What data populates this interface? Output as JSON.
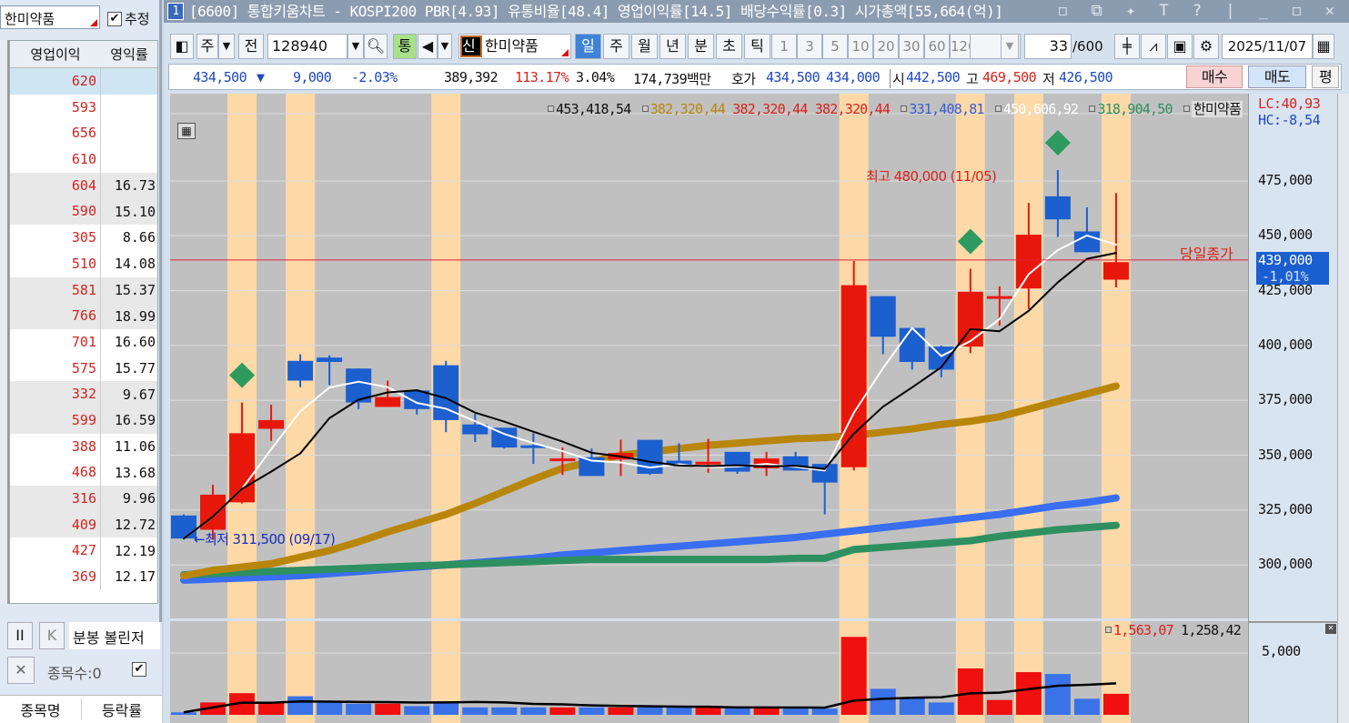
{
  "left_panel": {
    "search_value": "한미약품",
    "estimate_checkbox": {
      "label": "추정",
      "checked": true
    },
    "columns": [
      "영업이익",
      "영익률"
    ],
    "rows": [
      [
        "620",
        ""
      ],
      [
        "593",
        ""
      ],
      [
        "656",
        ""
      ],
      [
        "610",
        ""
      ],
      [
        "604",
        "16.73"
      ],
      [
        "590",
        "15.10"
      ],
      [
        "305",
        "8.66"
      ],
      [
        "510",
        "14.08"
      ],
      [
        "581",
        "15.37"
      ],
      [
        "766",
        "18.99"
      ],
      [
        "701",
        "16.60"
      ],
      [
        "575",
        "15.77"
      ],
      [
        "332",
        "9.67"
      ],
      [
        "599",
        "16.59"
      ],
      [
        "388",
        "11.06"
      ],
      [
        "468",
        "13.68"
      ],
      [
        "316",
        "9.96"
      ],
      [
        "409",
        "12.72"
      ],
      [
        "427",
        "12.19"
      ],
      [
        "369",
        "12.17"
      ]
    ],
    "bottom": {
      "pause": "II",
      "k": "K",
      "condition": "분봉 볼린저",
      "close": "✕",
      "count": "종목수:0",
      "columns": [
        "종목명",
        "등락률"
      ]
    }
  },
  "window": {
    "number": "1",
    "title": "[6600] 통합키움차트 - KOSPI200 PBR[4.93] 유통비율[48.4] 영업이익률[14.5] 배당수익률[0.3] 시가총액[55,664(억)]",
    "buttons": "◻ ⧉ ✦ T ? | _ ◻ ✕"
  },
  "toolbar": {
    "market": "주",
    "all": "전",
    "code": "128940",
    "tong": "통",
    "shin": "신",
    "name": "한미약품",
    "periods": [
      "일",
      "주",
      "월",
      "년",
      "분",
      "초",
      "틱"
    ],
    "active_period": "일",
    "intervals": [
      "1",
      "3",
      "5",
      "10",
      "20",
      "30",
      "60",
      "120"
    ],
    "count": "33",
    "count_total": "/600",
    "date": "2025/11/07"
  },
  "quote": {
    "price": "434,500",
    "arrow": "▼",
    "change": "9,000",
    "change_pct": "-2.03%",
    "volume": "389,392",
    "vol_ratio": "113.17%",
    "turnover": "3.04%",
    "amount": "174,739백만",
    "hoga_label": "호가",
    "ask": "434,500",
    "bid": "434,000",
    "open_label": "시",
    "open": "442,500",
    "high_label": "고",
    "high": "469,500",
    "low_label": "저",
    "low": "426,500",
    "buy": "매수",
    "sell": "매도",
    "eval": "평"
  },
  "legend": {
    "ma_black": "453,418,54",
    "ma_gold": "382,320,44",
    "red1": "382,320,44",
    "red2": "382,320,44",
    "ma_blue": "331,408,81",
    "ma_white": "450,606,92",
    "ma_green": "318,904,50",
    "name": "한미약품"
  },
  "right_axis": {
    "lc": "LC:40,93",
    "hc": "HC:-8,54",
    "ticks": [
      "475,000",
      "450,000",
      "425,000",
      "400,000",
      "375,000",
      "350,000",
      "325,000",
      "300,000"
    ],
    "close_value": "439,000",
    "close_pct": "-1,01%",
    "vol_tick": "5,000"
  },
  "annotations": {
    "high": "최고 480,000 (11/05)",
    "low": "←최저 311,500 (09/17)",
    "close_line": "당일종가"
  },
  "volume_legend": {
    "v1": "1,563,07",
    "v2": "1,258,42"
  },
  "colors": {
    "up": "#e8170c",
    "down": "#1c5fcf",
    "band": "#fdd9a8",
    "bg": "#c0c0c0",
    "gold": "#b8860b",
    "blue": "#3a6ef0",
    "green": "#2e9060",
    "signal": "#2e9a60"
  },
  "chart_data": {
    "type": "candlestick",
    "ylim": [
      290000,
      490000
    ],
    "close_line": 439000,
    "ohlc": [
      [
        322500,
        323000,
        311500,
        312000
      ],
      [
        316000,
        336500,
        311500,
        332000
      ],
      [
        328500,
        374000,
        328000,
        360000
      ],
      [
        362000,
        373000,
        356500,
        366000
      ],
      [
        393000,
        396000,
        381000,
        384000
      ],
      [
        394500,
        395500,
        382000,
        392500
      ],
      [
        389500,
        389500,
        371000,
        374000
      ],
      [
        372000,
        384000,
        372000,
        376500
      ],
      [
        379500,
        380000,
        368500,
        371000
      ],
      [
        391000,
        393000,
        360500,
        366000
      ],
      [
        364000,
        369000,
        356000,
        359500
      ],
      [
        362500,
        362500,
        353000,
        353500
      ],
      [
        354500,
        360000,
        346000,
        353500
      ],
      [
        347500,
        353500,
        341000,
        348500
      ],
      [
        349000,
        353000,
        340500,
        340500
      ],
      [
        348000,
        357000,
        340500,
        351000
      ],
      [
        357000,
        357000,
        341000,
        341500
      ],
      [
        347500,
        355500,
        345000,
        345000
      ],
      [
        346000,
        357500,
        342000,
        347000
      ],
      [
        351500,
        351500,
        341500,
        342500
      ],
      [
        344000,
        351500,
        340500,
        348500
      ],
      [
        349500,
        351500,
        343000,
        343000
      ],
      [
        346000,
        346000,
        323000,
        337500
      ],
      [
        344500,
        438500,
        343000,
        427500
      ],
      [
        422500,
        422500,
        396000,
        404000
      ],
      [
        408000,
        408500,
        389000,
        392500
      ],
      [
        399500,
        400000,
        385500,
        389000
      ],
      [
        399500,
        435000,
        396500,
        424500
      ],
      [
        421500,
        427000,
        409000,
        422500
      ],
      [
        426000,
        465000,
        416500,
        450500
      ],
      [
        468000,
        480000,
        449500,
        457500
      ],
      [
        452000,
        463000,
        442500,
        442500
      ],
      [
        430000,
        469500,
        426500,
        438000
      ]
    ],
    "candle_colors": [
      "d",
      "u",
      "u",
      "u",
      "d",
      "d",
      "d",
      "u",
      "d",
      "d",
      "d",
      "d",
      "d",
      "u",
      "d",
      "u",
      "d",
      "d",
      "u",
      "d",
      "u",
      "d",
      "d",
      "u",
      "d",
      "d",
      "d",
      "u",
      "u",
      "u",
      "d",
      "d",
      "u"
    ],
    "band_indices": [
      2,
      4,
      9,
      23,
      27,
      29,
      32
    ],
    "signal_indices": [
      2,
      27,
      30
    ],
    "ma_gold": [
      295000,
      297500,
      299000,
      300500,
      303500,
      306500,
      310500,
      315000,
      319000,
      323000,
      328000,
      333500,
      339000,
      344000,
      347000,
      350000,
      351500,
      353000,
      354500,
      355500,
      356500,
      357500,
      358000,
      359000,
      360500,
      362000,
      364000,
      365500,
      367500,
      371000,
      374500,
      378000,
      381500
    ],
    "ma_blue": [
      293000,
      293500,
      294000,
      294500,
      295000,
      296000,
      297000,
      298000,
      299000,
      300000,
      301000,
      302000,
      303000,
      304500,
      305500,
      306500,
      307500,
      308500,
      309500,
      310500,
      311500,
      312500,
      314000,
      315500,
      317000,
      318500,
      320000,
      321500,
      323000,
      325000,
      327000,
      328500,
      330500
    ],
    "ma_green": [
      295500,
      296000,
      296500,
      297000,
      297500,
      298000,
      298500,
      299000,
      299500,
      300000,
      300500,
      301000,
      301500,
      302000,
      302500,
      302500,
      302500,
      302500,
      302500,
      302500,
      302500,
      303000,
      303000,
      307000,
      308000,
      309000,
      310000,
      311000,
      313000,
      314500,
      316000,
      317000,
      318000
    ],
    "volume": [
      0.2,
      1.0,
      1.75,
      0.95,
      1.5,
      1.0,
      0.9,
      0.9,
      0.7,
      1.1,
      0.6,
      0.6,
      0.6,
      0.6,
      0.6,
      0.6,
      0.6,
      0.6,
      0.6,
      0.6,
      0.6,
      0.5,
      0.5,
      6.3,
      2.1,
      1.4,
      1.0,
      3.75,
      1.2,
      3.45,
      3.3,
      1.3,
      1.7
    ],
    "volume_unit_tick": 5000,
    "volume_scale": 1000
  }
}
